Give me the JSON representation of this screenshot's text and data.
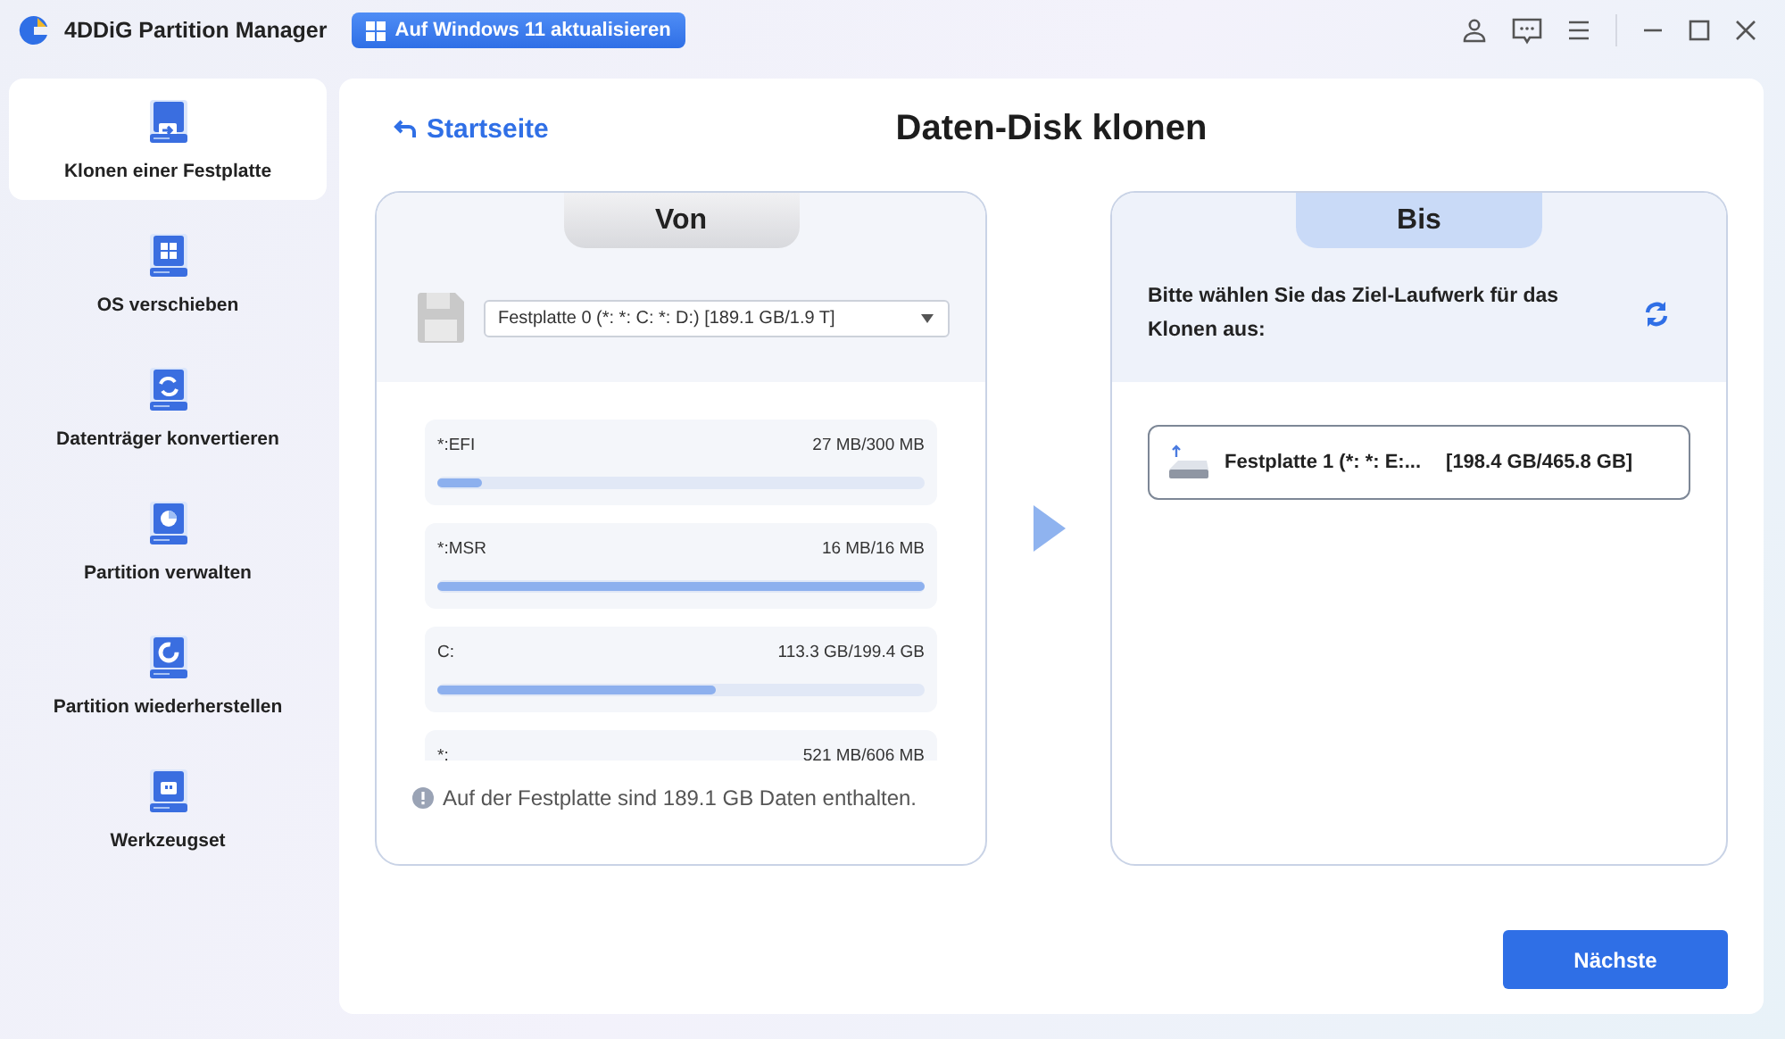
{
  "window": {
    "title": "4DDiG Partition Manager",
    "upgrade_button": "Auf Windows 11 aktualisieren"
  },
  "sidebar": {
    "items": [
      {
        "label": "Klonen einer Festplatte",
        "selected": true
      },
      {
        "label": "OS verschieben",
        "selected": false
      },
      {
        "label": "Datenträger konvertieren",
        "selected": false
      },
      {
        "label": "Partition verwalten",
        "selected": false
      },
      {
        "label": "Partition wiederherstellen",
        "selected": false
      },
      {
        "label": "Werkzeugset",
        "selected": false
      }
    ]
  },
  "main": {
    "back_link": "Startseite",
    "title": "Daten-Disk klonen",
    "source": {
      "tab": "Von",
      "disk_select": "Festplatte 0 (*: *: C: *: D:) [189.1 GB/1.9 T]",
      "partitions": [
        {
          "name": "*:EFI",
          "usage": "27 MB/300 MB",
          "level": 0.09
        },
        {
          "name": "*:MSR",
          "usage": "16 MB/16 MB",
          "level": 1
        },
        {
          "name": "C:",
          "usage": "113.3 GB/199.4 GB",
          "level": 0.57
        },
        {
          "name": "*:",
          "usage": "521 MB/606 MB"
        }
      ],
      "note": "Auf der Festplatte sind 189.1 GB Daten enthalten."
    },
    "target": {
      "tab": "Bis",
      "prompt": "Bitte wählen Sie das Ziel-Laufwerk für das Klonen aus:",
      "disks": [
        {
          "name": "Festplatte 1 (*: *: E:...",
          "size": "[198.4 GB/465.8 GB]"
        }
      ]
    },
    "next_button": "Nächste"
  }
}
